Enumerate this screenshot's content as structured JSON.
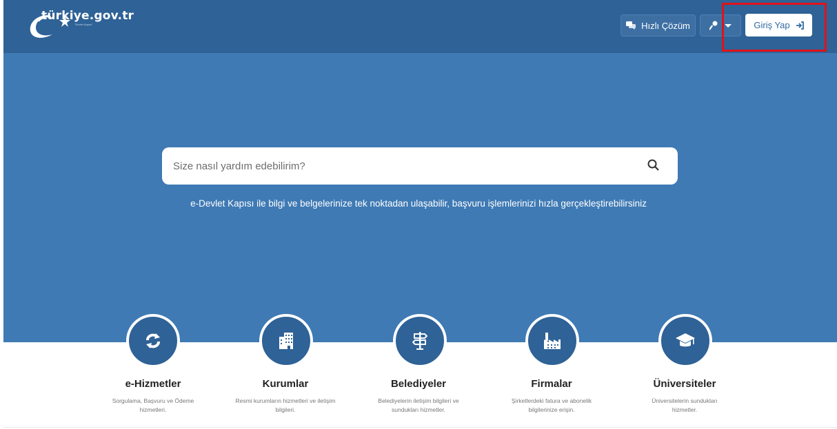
{
  "header": {
    "logo_text": "türkiye.gov.tr",
    "logo_tagline": "\"Devlet Kapısı\"",
    "hizli_cozum_label": "Hızlı Çözüm",
    "giris_yap_label": "Giriş Yap"
  },
  "hero": {
    "search_placeholder": "Size nasıl yardım edebilirim?",
    "tagline": "e-Devlet Kapısı ile bilgi ve belgelerinize tek noktadan ulaşabilir, başvuru işlemlerinizi hızla gerçekleştirebilirsiniz"
  },
  "categories": [
    {
      "title": "e-Hizmetler",
      "desc": "Sorgulama, Başvuru ve Ödeme hizmetleri.",
      "icon": "refresh-icon"
    },
    {
      "title": "Kurumlar",
      "desc": "Resmi kurumların hizmetleri ve iletişim bilgileri.",
      "icon": "building-icon"
    },
    {
      "title": "Belediyeler",
      "desc": "Belediyelerin iletişim bilgileri ve sundukları hizmetler.",
      "icon": "signpost-icon"
    },
    {
      "title": "Firmalar",
      "desc": "Şirketlerdeki fatura ve abonelik bilgilerinize erişin.",
      "icon": "factory-icon"
    },
    {
      "title": "Üniversiteler",
      "desc": "Üniversitelerin sundukları hizmetler.",
      "icon": "graduation-cap-icon"
    }
  ],
  "colors": {
    "header_bg": "#2f6296",
    "hero_bg": "#3f7ab4",
    "highlight": "#e01219",
    "accent_text": "#2f6aa3"
  }
}
